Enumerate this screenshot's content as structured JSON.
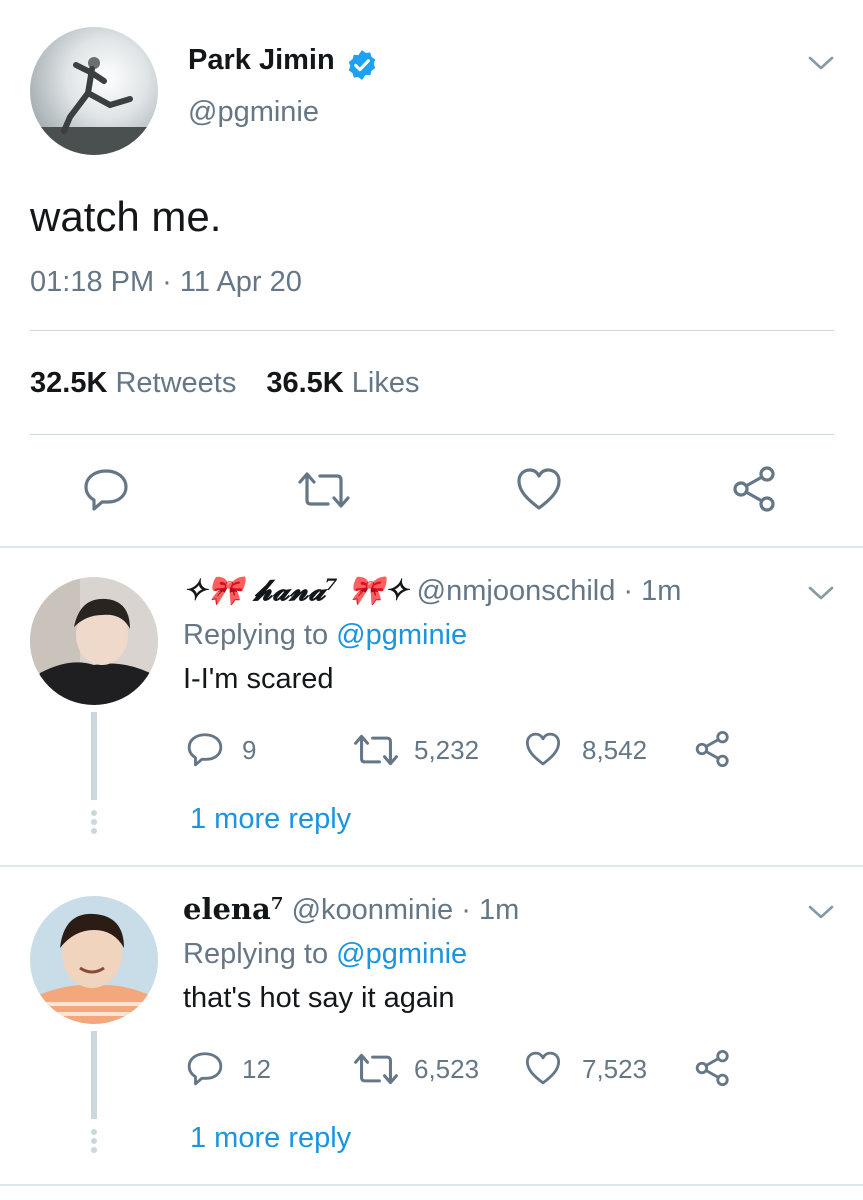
{
  "main_tweet": {
    "author_name": "Park Jimin",
    "author_handle": "@pgminie",
    "verified": true,
    "text": "watch me.",
    "timestamp": "01:18 PM · 11 Apr 20",
    "retweets_count": "32.5K",
    "retweets_label": "Retweets",
    "likes_count": "36.5K",
    "likes_label": "Likes",
    "actions": [
      "reply-icon",
      "retweet-icon",
      "like-icon",
      "share-icon"
    ]
  },
  "replies": [
    {
      "display_name": "✧🎀 𝓱𝓪𝓷𝓪⁷ 🎀✧",
      "handle_time": "@nmjoonschild · 1m",
      "replying_prefix": "Replying to ",
      "replying_to": "@pgminie",
      "text": "I-I'm scared",
      "reply_count": "9",
      "retweet_count": "5,232",
      "like_count": "8,542",
      "more_replies": "1 more reply"
    },
    {
      "display_name": "elena⁷",
      "handle_time": "@koonminie · 1m",
      "replying_prefix": "Replying to ",
      "replying_to": "@pgminie",
      "text": "that's hot say it again",
      "reply_count": "12",
      "retweet_count": "6,523",
      "like_count": "7,523",
      "more_replies": "1 more reply"
    }
  ],
  "colors": {
    "primary_text": "#14171a",
    "secondary_text": "#657786",
    "link": "#1b95e0",
    "verified_badge": "#1da1f2",
    "divider": "#ccd6dd"
  }
}
